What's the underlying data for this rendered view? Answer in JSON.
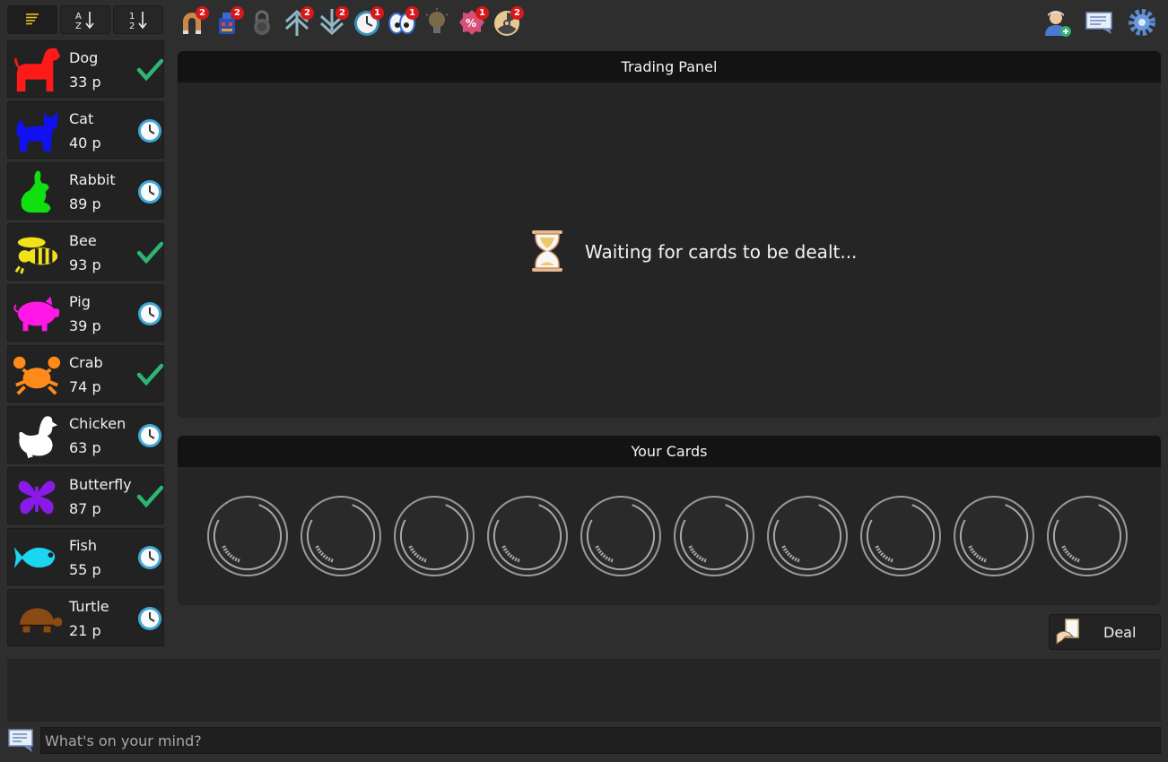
{
  "sort_buttons": [
    {
      "name": "sort-default-button",
      "icon": "lines-icon"
    },
    {
      "name": "sort-alpha-button",
      "icon": "sort-az-icon"
    },
    {
      "name": "sort-numeric-button",
      "icon": "sort-12-icon"
    }
  ],
  "toolbar": {
    "tools": [
      {
        "name": "magnet",
        "badge": "2"
      },
      {
        "name": "robot",
        "badge": "2"
      },
      {
        "name": "lock",
        "badge": ""
      },
      {
        "name": "arrows-up",
        "badge": "2"
      },
      {
        "name": "arrows-down",
        "badge": "2"
      },
      {
        "name": "clock",
        "badge": "1"
      },
      {
        "name": "eyes",
        "badge": "1"
      },
      {
        "name": "lightbulb",
        "badge": ""
      },
      {
        "name": "percent-badge",
        "badge": "1"
      },
      {
        "name": "radiation",
        "badge": "2"
      }
    ],
    "right": [
      "add-user",
      "chat-window",
      "settings-gear"
    ]
  },
  "animals": [
    {
      "name": "Dog",
      "price": "33 p",
      "color": "#ff1a1a",
      "status": "check"
    },
    {
      "name": "Cat",
      "price": "40 p",
      "color": "#1010f0",
      "status": "clock"
    },
    {
      "name": "Rabbit",
      "price": "89 p",
      "color": "#10e010",
      "status": "clock"
    },
    {
      "name": "Bee",
      "price": "93 p",
      "color": "#f2e21a",
      "status": "check"
    },
    {
      "name": "Pig",
      "price": "39 p",
      "color": "#ff18e6",
      "status": "clock"
    },
    {
      "name": "Crab",
      "price": "74 p",
      "color": "#ff8a1a",
      "status": "check"
    },
    {
      "name": "Chicken",
      "price": "63 p",
      "color": "#ffffff",
      "status": "clock"
    },
    {
      "name": "Butterfly",
      "price": "87 p",
      "color": "#8a1ae8",
      "status": "check"
    },
    {
      "name": "Fish",
      "price": "55 p",
      "color": "#1ad6f0",
      "status": "clock"
    },
    {
      "name": "Turtle",
      "price": "21 p",
      "color": "#8a4a14",
      "status": "clock"
    }
  ],
  "trading_panel": {
    "title": "Trading Panel",
    "waiting_text": "Waiting for cards to be dealt..."
  },
  "cards_panel": {
    "title": "Your Cards",
    "slot_count": 10
  },
  "deal_button": {
    "label": "Deal"
  },
  "chat": {
    "placeholder": "What's on your mind?"
  }
}
